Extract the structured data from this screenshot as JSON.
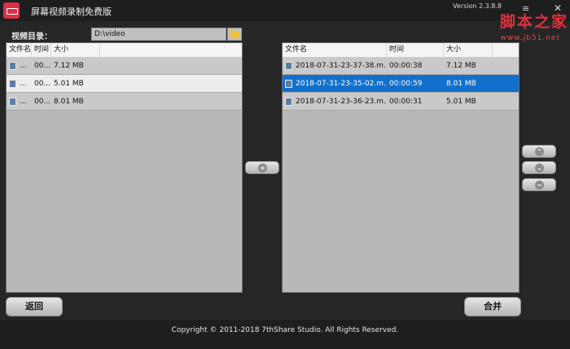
{
  "window": {
    "title": "屏幕视频录制免费版",
    "version": "Version 2.3.8.8",
    "menu_glyph": "≡",
    "close_glyph": "✕",
    "watermark": "脚本之家",
    "watermark_url": "www.jb51.net"
  },
  "directory": {
    "label": "视频目录：",
    "value": "D:\\video"
  },
  "left_table": {
    "headers": [
      "文件名",
      "时间",
      "大小"
    ],
    "rows": [
      {
        "name": "...",
        "time": "00...",
        "size": "7.12 MB"
      },
      {
        "name": "...",
        "time": "00...",
        "size": "5.01 MB"
      },
      {
        "name": "...",
        "time": "00...",
        "size": "8.01 MB"
      }
    ]
  },
  "right_table": {
    "headers": [
      "文件名",
      "时间",
      "大小"
    ],
    "rows": [
      {
        "name": "2018-07-31-23-37-38.m...",
        "time": "00:00:38",
        "size": "7.12 MB"
      },
      {
        "name": "2018-07-31-23-35-02.m...",
        "time": "00:00:59",
        "size": "8.01 MB"
      },
      {
        "name": "2018-07-31-23-36-23.m...",
        "time": "00:00:31",
        "size": "5.01 MB"
      }
    ]
  },
  "buttons": {
    "back": "返回",
    "merge": "合并",
    "add_glyph": "+",
    "up_glyph": "⌃",
    "down_glyph": "⌄",
    "remove_glyph": "−"
  },
  "footer": "Copyright © 2011-2018 7thShare Studio. All Rights Reserved.",
  "colors": {
    "accent_selected": "#1270cc",
    "panel": "#b8b8b8",
    "background": "#262626",
    "watermark": "#e0323c"
  }
}
